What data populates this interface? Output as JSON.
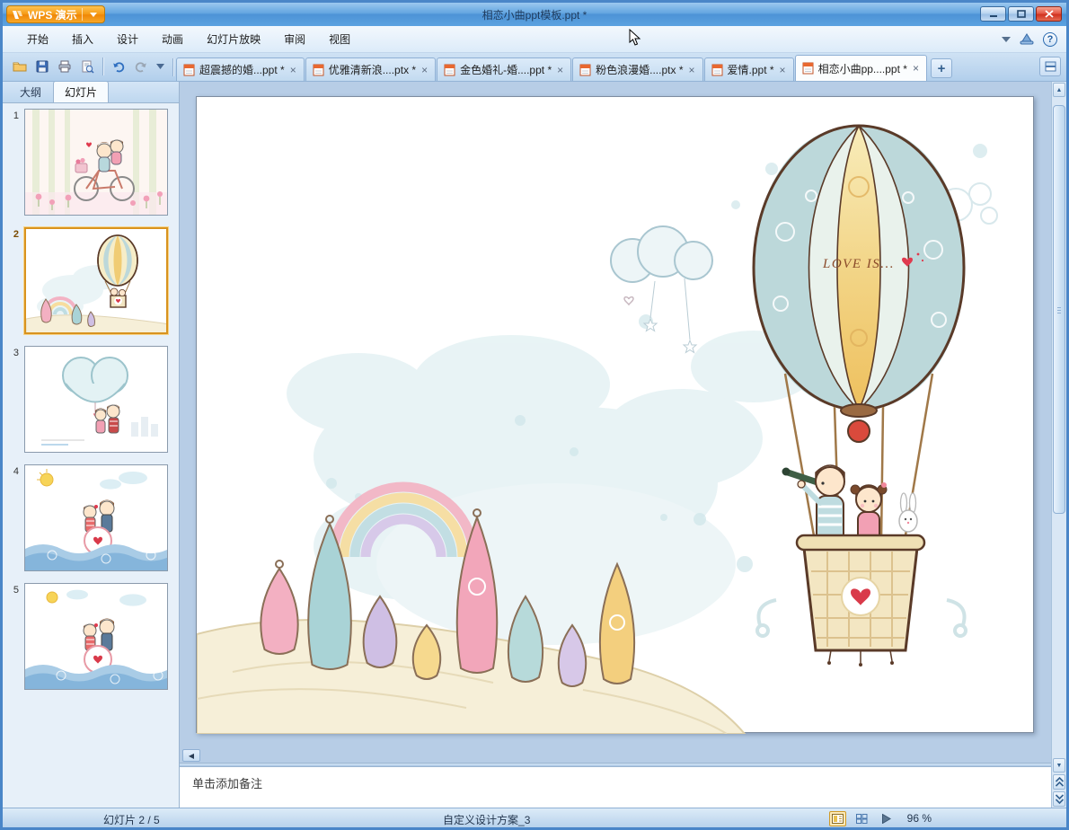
{
  "window": {
    "app_button": "WPS 演示",
    "title": "相恋小曲ppt模板.ppt *"
  },
  "menu": {
    "items": [
      "开始",
      "插入",
      "设计",
      "动画",
      "幻灯片放映",
      "审阅",
      "视图"
    ]
  },
  "tabs": {
    "documents": [
      {
        "label": "超震撼的婚...ppt *"
      },
      {
        "label": "优雅清新浪....ptx *"
      },
      {
        "label": "金色婚礼-婚....ppt *"
      },
      {
        "label": "粉色浪漫婚....ptx *"
      },
      {
        "label": "爱情.ppt *"
      },
      {
        "label": "相恋小曲pp....ppt *"
      }
    ],
    "close_glyph": "×",
    "new_tab": "+"
  },
  "sidebar": {
    "outline_tab": "大纲",
    "slides_tab": "幻灯片",
    "slides": [
      {
        "num": "1"
      },
      {
        "num": "2"
      },
      {
        "num": "3"
      },
      {
        "num": "4"
      },
      {
        "num": "5"
      }
    ]
  },
  "slide": {
    "balloon_text": "LOVE IS..."
  },
  "notes": {
    "placeholder": "单击添加备注"
  },
  "status": {
    "slide_indicator": "幻灯片 2 / 5",
    "design_scheme": "自定义设计方案_3",
    "zoom": "96 %"
  },
  "icons": {
    "help": "?",
    "left": "◀",
    "up": "▲",
    "down": "▼"
  }
}
